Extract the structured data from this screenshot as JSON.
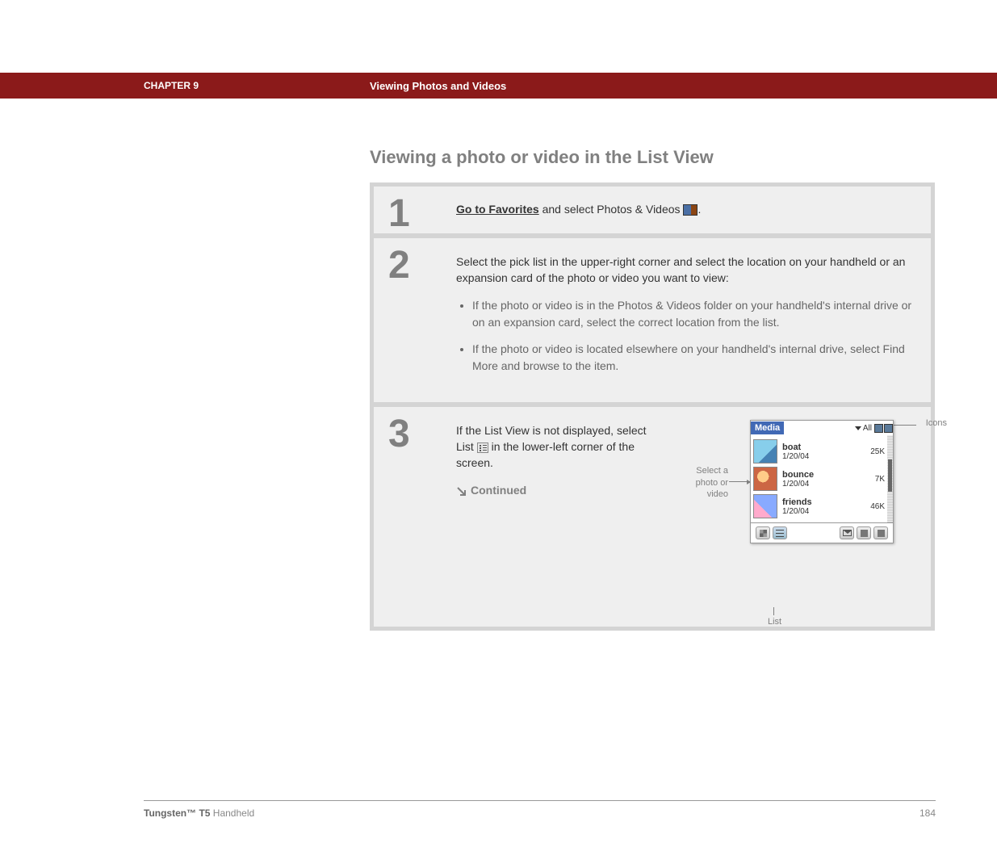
{
  "header": {
    "chapter": "CHAPTER 9",
    "title": "Viewing Photos and Videos"
  },
  "section_title": "Viewing a photo or video in the List View",
  "steps": {
    "s1": {
      "num": "1",
      "link": "Go to Favorites",
      "text_after_link": " and select Photos & Videos ",
      "period": "."
    },
    "s2": {
      "num": "2",
      "lead": "Select the pick list in the upper-right corner and select the location on your handheld or an expansion card of the photo or video you want to view:",
      "bullets": [
        "If the photo or video is in the Photos & Videos folder on your handheld's internal drive or on an expansion card, select the correct location from the list.",
        "If the photo or video is located elsewhere on your handheld's internal drive, select Find More and browse to the item."
      ]
    },
    "s3": {
      "num": "3",
      "text_before": "If the List View is not displayed, select List ",
      "text_after": " in the lower-left corner of the screen.",
      "continued": "Continued",
      "callouts": {
        "left": "Select a photo or video",
        "right": "Icons",
        "bottom": "List"
      },
      "screenshot": {
        "media_label": "Media",
        "dropdown": "All",
        "rows": [
          {
            "name": "boat",
            "date": "1/20/04",
            "size": "25K"
          },
          {
            "name": "bounce",
            "date": "1/20/04",
            "size": "7K"
          },
          {
            "name": "friends",
            "date": "1/20/04",
            "size": "46K"
          }
        ]
      }
    }
  },
  "footer": {
    "product_strong": "Tungsten™ T5",
    "product_rest": " Handheld",
    "page": "184"
  }
}
